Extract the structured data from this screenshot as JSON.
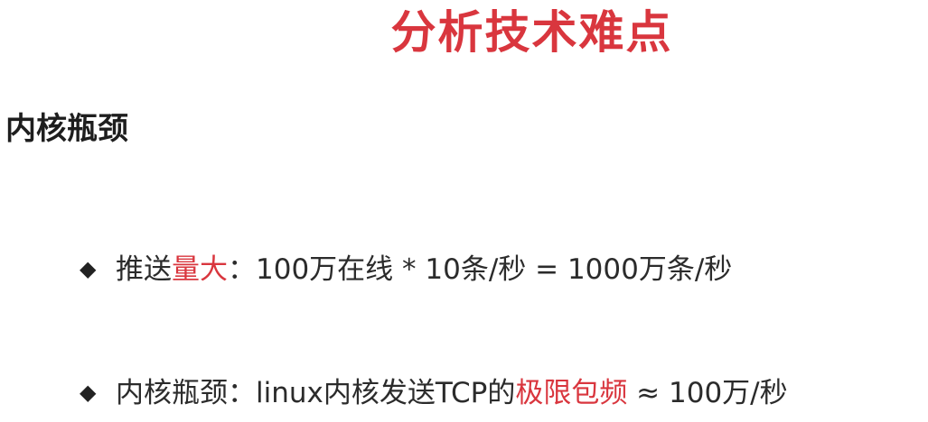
{
  "slide": {
    "title": "分析技术难点",
    "section_heading": "内核瓶颈",
    "bullets": [
      {
        "marker": "◆",
        "prefix": "推送",
        "highlight": "量大",
        "suffix": "：100万在线 * 10条/秒 = 1000万条/秒"
      },
      {
        "marker": "◆",
        "prefix": "内核瓶颈：linux内核发送TCP的",
        "highlight": "极限包频",
        "suffix": " ≈ 100万/秒"
      }
    ]
  },
  "colors": {
    "accent": "#d9363e",
    "text": "#2b2b2b",
    "background": "#ffffff"
  }
}
